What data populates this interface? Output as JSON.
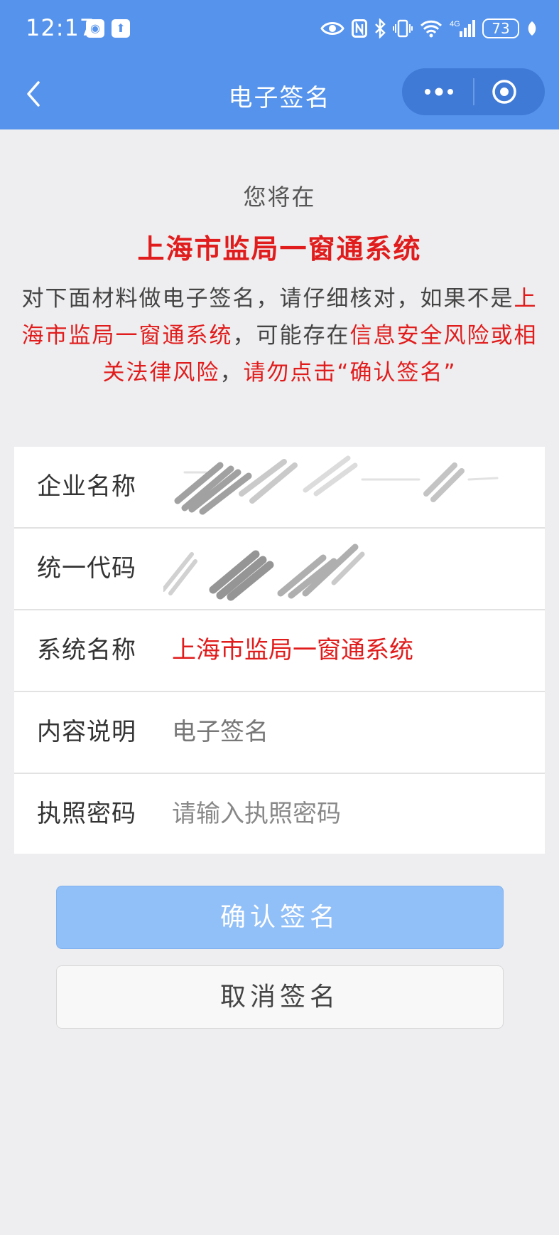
{
  "status_bar": {
    "time": "12:17",
    "battery": "73",
    "network": "4G"
  },
  "nav": {
    "title": "电子签名"
  },
  "intro": {
    "you_will": "您将在",
    "system_name": "上海市监局一窗通系统",
    "notice_1": "对下面材料做电子签名，请仔细核对，如果不是",
    "notice_2_red": "上海市监局一窗通系统",
    "notice_3": "，可能存在",
    "notice_4_red": "信息安全风险或相关法律风险",
    "notice_5": "，",
    "notice_6_red": "请勿点击“确认签名”"
  },
  "form": {
    "company_label": "企业名称",
    "code_label": "统一代码",
    "system_label": "系统名称",
    "system_value": "上海市监局一窗通系统",
    "content_label": "内容说明",
    "content_value": "电子签名",
    "password_label": "执照密码",
    "password_placeholder": "请输入执照密码"
  },
  "buttons": {
    "confirm": "确认签名",
    "cancel": "取消签名"
  },
  "colors": {
    "brand_blue": "#5593ec",
    "warning_red": "#e11c1c",
    "confirm_disabled": "#91bff7"
  }
}
